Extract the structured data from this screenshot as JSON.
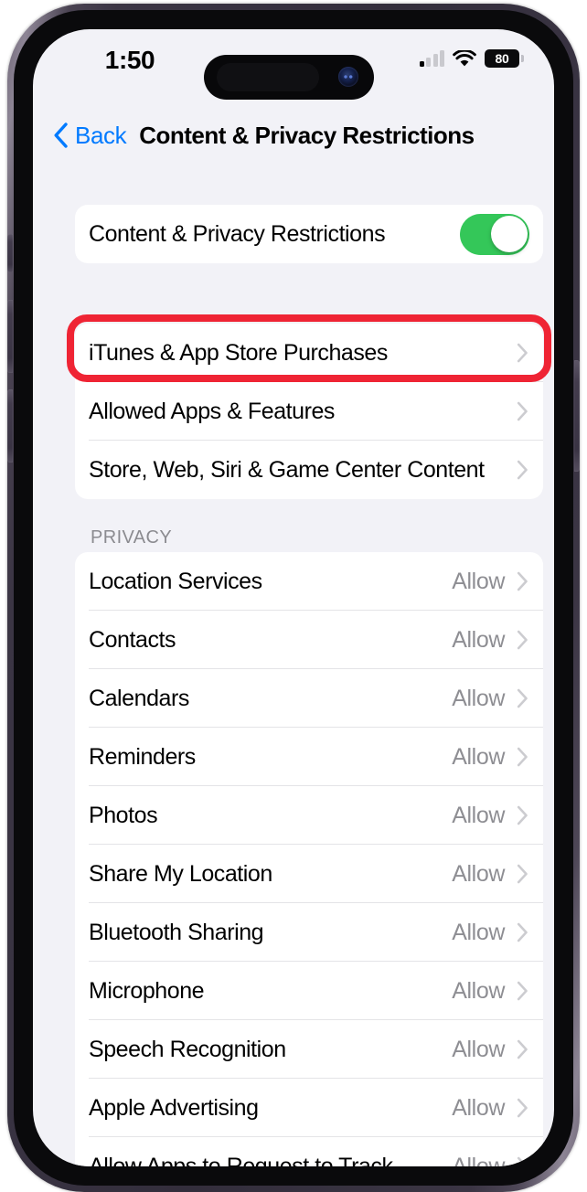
{
  "status_bar": {
    "time": "1:50",
    "cellular_icon": "cellular-bars-icon",
    "wifi_icon": "wifi-icon",
    "battery_icon": "battery-icon",
    "battery_level": "80"
  },
  "nav": {
    "back_label": "Back",
    "back_icon": "chevron-left-icon",
    "title": "Content & Privacy Restrictions"
  },
  "toggle_section": {
    "label": "Content & Privacy Restrictions",
    "enabled": true,
    "switch_color": "#34C759"
  },
  "highlight": {
    "color": "#ef2434",
    "target": "iTunes & App Store Purchases"
  },
  "restrictions": [
    {
      "label": "iTunes & App Store Purchases",
      "value": "",
      "chevron": "chevron-right-icon"
    },
    {
      "label": "Allowed Apps & Features",
      "value": "",
      "chevron": "chevron-right-icon"
    },
    {
      "label": "Store, Web, Siri & Game Center Content",
      "value": "",
      "chevron": "chevron-right-icon"
    }
  ],
  "privacy": {
    "header": "PRIVACY",
    "items": [
      {
        "label": "Location Services",
        "value": "Allow",
        "chevron": "chevron-right-icon"
      },
      {
        "label": "Contacts",
        "value": "Allow",
        "chevron": "chevron-right-icon"
      },
      {
        "label": "Calendars",
        "value": "Allow",
        "chevron": "chevron-right-icon"
      },
      {
        "label": "Reminders",
        "value": "Allow",
        "chevron": "chevron-right-icon"
      },
      {
        "label": "Photos",
        "value": "Allow",
        "chevron": "chevron-right-icon"
      },
      {
        "label": "Share My Location",
        "value": "Allow",
        "chevron": "chevron-right-icon"
      },
      {
        "label": "Bluetooth Sharing",
        "value": "Allow",
        "chevron": "chevron-right-icon"
      },
      {
        "label": "Microphone",
        "value": "Allow",
        "chevron": "chevron-right-icon"
      },
      {
        "label": "Speech Recognition",
        "value": "Allow",
        "chevron": "chevron-right-icon"
      },
      {
        "label": "Apple Advertising",
        "value": "Allow",
        "chevron": "chevron-right-icon"
      },
      {
        "label": "Allow Apps to Request to Track",
        "value": "Allow",
        "chevron": "chevron-right-icon"
      }
    ]
  },
  "device": {
    "side_buttons": [
      "action-button",
      "volume-up-button",
      "volume-down-button",
      "power-button"
    ],
    "dynamic_island": "dynamic-island",
    "front_camera": "front-camera"
  }
}
